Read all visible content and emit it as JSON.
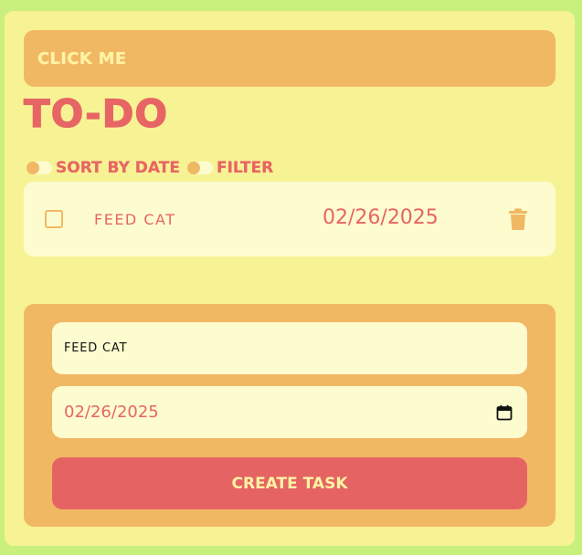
{
  "header": {
    "click_label": "CLICK ME"
  },
  "title": "TO-DO",
  "controls": {
    "sort_label": "SORT BY DATE",
    "filter_label": "FILTER"
  },
  "tasks": [
    {
      "name": "FEED CAT",
      "date": "02/26/2025",
      "completed": false
    }
  ],
  "form": {
    "name_value": "FEED CAT",
    "date_value": "02/26/2025",
    "create_label": "CREATE TASK"
  },
  "icons": {
    "delete": "trash-icon",
    "calendar": "calendar-icon"
  },
  "colors": {
    "background": "#c9f07c",
    "panel": "#f7f394",
    "accent_orange": "#f1b864",
    "accent_red": "#e76564",
    "card": "#fdfccf",
    "text_light": "#fff3a4"
  }
}
